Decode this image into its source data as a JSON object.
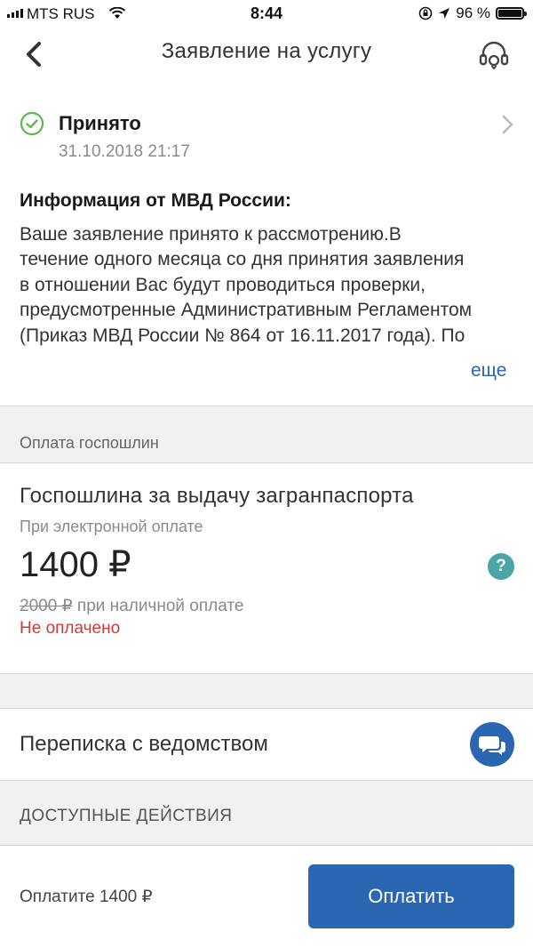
{
  "status_bar": {
    "carrier": "MTS RUS",
    "time": "8:44",
    "battery": "96 %"
  },
  "header": {
    "title": "Заявление на услугу"
  },
  "application_status": {
    "label": "Принято",
    "date": "31.10.2018 21:17"
  },
  "info": {
    "title": "Информация от МВД России:",
    "text": "Ваше заявление принято к рассмотрению.В течение одного месяца со дня принятия заявления в отношении Вас будут проводиться проверки, предусмотренные Административным Регламентом (Приказ МВД России № 864 от 16.11.2017 года). По",
    "more_label": "еще"
  },
  "fees": {
    "section_label": "Оплата госпошлин",
    "title": "Госпошлина за выдачу загранпаспорта",
    "subtitle": "При электронной оплате",
    "amount": "1400 ₽",
    "cash_amount": "2000 ₽",
    "cash_note": " при наличной оплате",
    "payment_status": "Не оплачено",
    "help_icon_glyph": "?"
  },
  "correspondence": {
    "label": "Переписка с ведомством"
  },
  "actions": {
    "section_label": "ДОСТУПНЫЕ ДЕЙСТВИЯ"
  },
  "footer": {
    "pay_text": "Оплатите 1400 ₽",
    "pay_button": "Оплатить"
  },
  "colors": {
    "accent": "#2b66b3",
    "success": "#5fb84a",
    "error": "#d23a3a",
    "help": "#4aa5a4"
  },
  "icons": [
    "signal-icon",
    "wifi-icon",
    "lock-rotation-icon",
    "location-arrow-icon",
    "battery-icon",
    "back-chevron-icon",
    "support-headset-icon",
    "check-circle-icon",
    "chevron-right-icon",
    "help-icon",
    "chat-bubbles-icon"
  ]
}
